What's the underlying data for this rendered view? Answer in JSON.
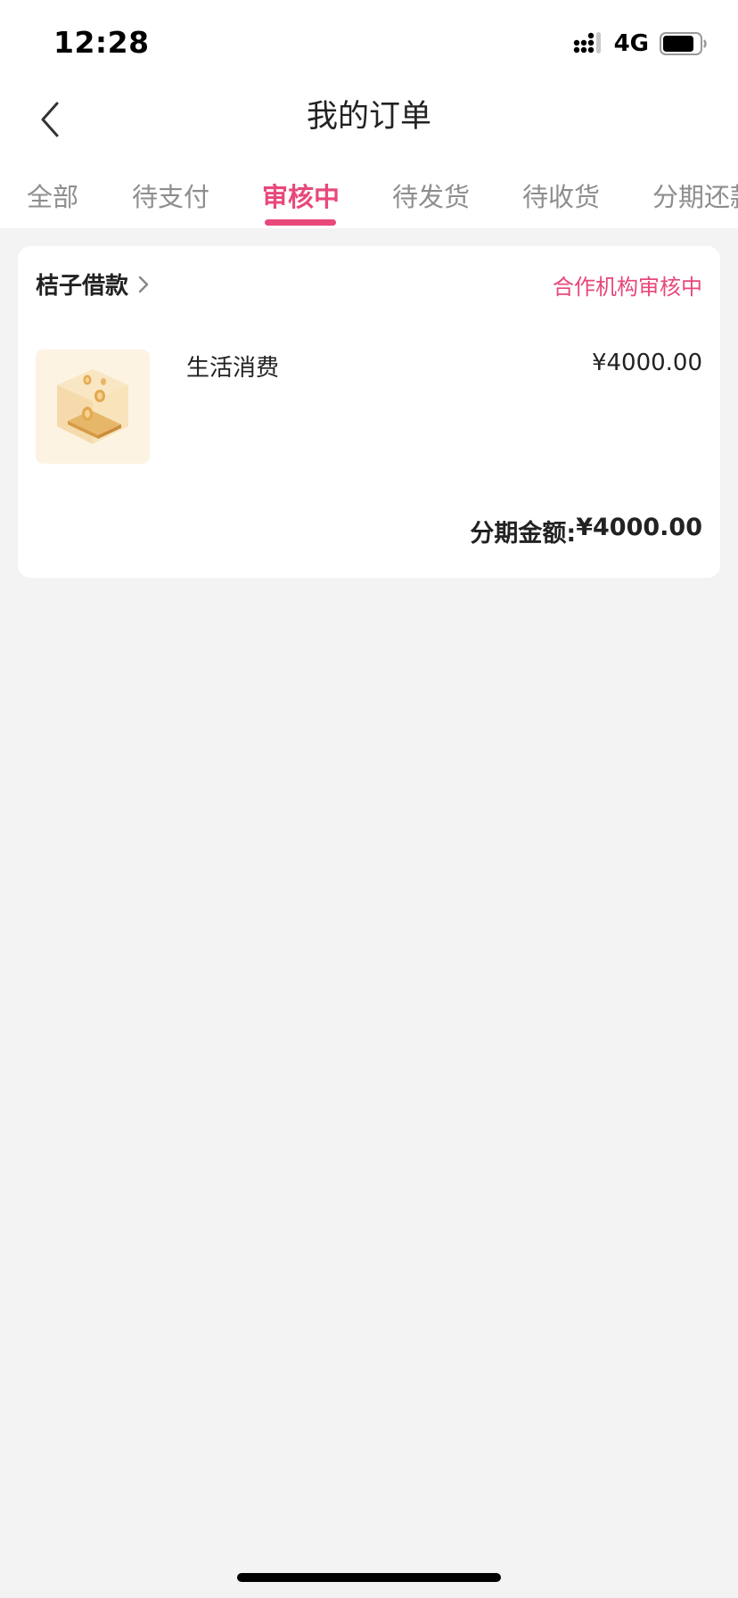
{
  "status_bar": {
    "time": "12:28",
    "network": "4G",
    "signal_icon": "signal-bars-icon",
    "battery_icon": "battery-icon"
  },
  "nav": {
    "back_icon": "chevron-left-icon",
    "title": "我的订单"
  },
  "tabs": [
    {
      "label": "全部",
      "active": false
    },
    {
      "label": "待支付",
      "active": false
    },
    {
      "label": "审核中",
      "active": true
    },
    {
      "label": "待发货",
      "active": false
    },
    {
      "label": "待收货",
      "active": false
    },
    {
      "label": "分期还款",
      "active": false
    }
  ],
  "order": {
    "merchant": "桔子借款",
    "merchant_chevron_icon": "chevron-right-icon",
    "status": "合作机构审核中",
    "product_image_icon": "coin-box-icon",
    "product_name": "生活消费",
    "price": "¥4000.00",
    "installment_label": "分期金额:",
    "installment_amount": "¥4000.00"
  },
  "colors": {
    "accent": "#e8487a",
    "background": "#f3f3f3",
    "card": "#ffffff",
    "inactive_tab": "#8e8e8e"
  }
}
